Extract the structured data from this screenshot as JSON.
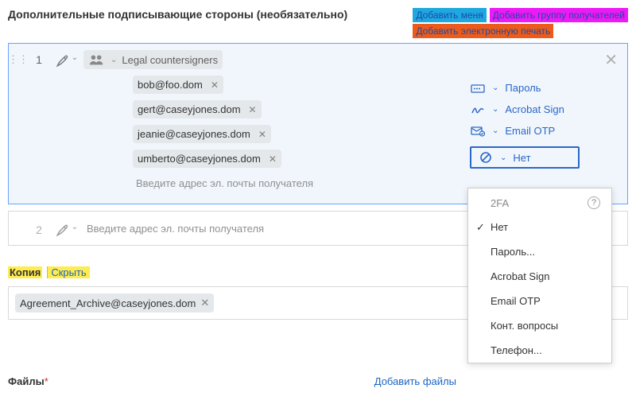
{
  "header": {
    "title": "Дополнительные подписывающие стороны (необязательно)",
    "tags": {
      "add_me": "Добавить меня",
      "add_group": "Добавить группу получателей",
      "add_eseal": "Добавить электронную печать"
    }
  },
  "recipient1": {
    "index": "1",
    "group_label": "Legal countersigners",
    "members": [
      "bob@foo.dom",
      "gert@caseyjones.dom",
      "jeanie@caseyjones.dom",
      "umberto@caseyjones.dom"
    ],
    "placeholder": "Введите адрес эл. почты получателя",
    "auth": {
      "password": "Пароль",
      "acrobat": "Acrobat Sign",
      "emailotp": "Email OTP",
      "current": "Нет"
    }
  },
  "recipient2": {
    "index": "2",
    "placeholder": "Введите адрес эл. почты получателя"
  },
  "auth_dropdown": {
    "header": "2FA",
    "items": {
      "none": "Нет",
      "password": "Пароль...",
      "acrobat": "Acrobat Sign",
      "emailotp": "Email OTP",
      "kba": "Конт. вопросы",
      "phone": "Телефон..."
    }
  },
  "cc": {
    "label": "Копия",
    "hide": "Скрыть",
    "chip": "Agreement_Archive@caseyjones.dom"
  },
  "files": {
    "label": "Файлы",
    "star": "*",
    "add": "Добавить файлы"
  }
}
